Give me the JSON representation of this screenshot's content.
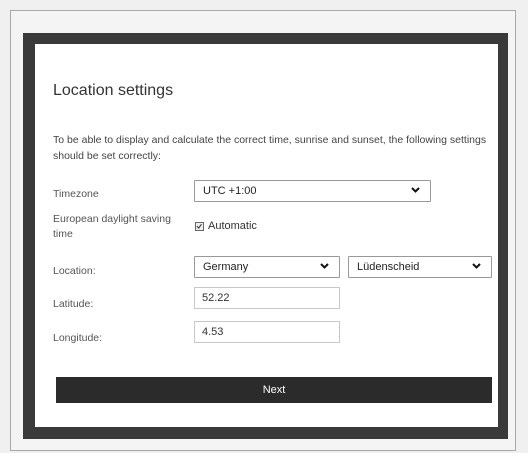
{
  "title": "Location settings",
  "intro": "To be able to display and calculate the correct time, sunrise and sunset, the following settings should be set correctly:",
  "fields": {
    "timezone": {
      "label": "Timezone",
      "value": "UTC +1:00"
    },
    "dst": {
      "label": "European daylight saving time",
      "option": "Automatic",
      "checked": true
    },
    "location": {
      "label": "Location:",
      "country": "Germany",
      "city": "Lüdenscheid"
    },
    "latitude": {
      "label": "Latitude:",
      "value": "52.22"
    },
    "longitude": {
      "label": "Longitude:",
      "value": "4.53"
    }
  },
  "buttons": {
    "next": "Next"
  },
  "icons": {
    "dropdown": "chevron-down-icon",
    "checkbox": "checkbox-icon"
  }
}
